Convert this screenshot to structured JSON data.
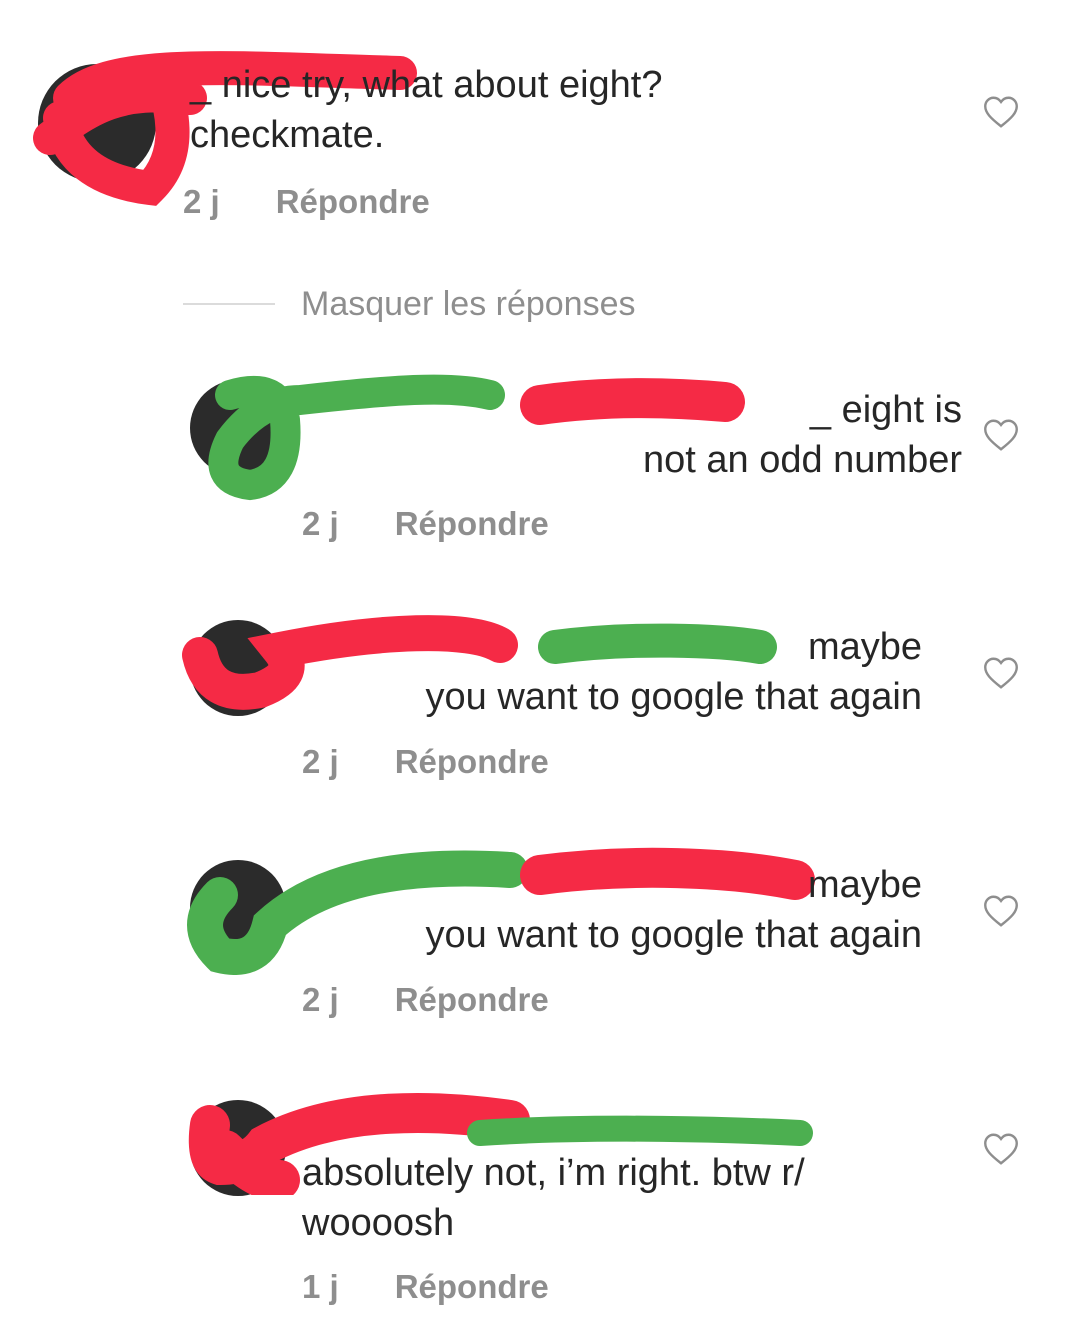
{
  "comments": [
    {
      "text": "_ nice try, what about eight?\ncheckmate.",
      "time": "2 j",
      "reply": "Répondre"
    },
    {
      "text": "_ eight is\nnot an odd number",
      "time": "2 j",
      "reply": "Répondre"
    },
    {
      "text": "maybe\nyou want to google that again",
      "time": "2 j",
      "reply": "Répondre"
    },
    {
      "text": "maybe\nyou want to google that again",
      "time": "2 j",
      "reply": "Répondre"
    },
    {
      "text": "absolutely not, i’m right. btw r/\nwoooosh",
      "time": "1 j",
      "reply": "Répondre"
    }
  ],
  "hide_replies": "Masquer les réponses",
  "colors": {
    "redact_red": "#f52a45",
    "redact_green": "#4caf50",
    "muted": "#8e8e8e"
  },
  "icons": {
    "like": "heart-outline-icon"
  }
}
